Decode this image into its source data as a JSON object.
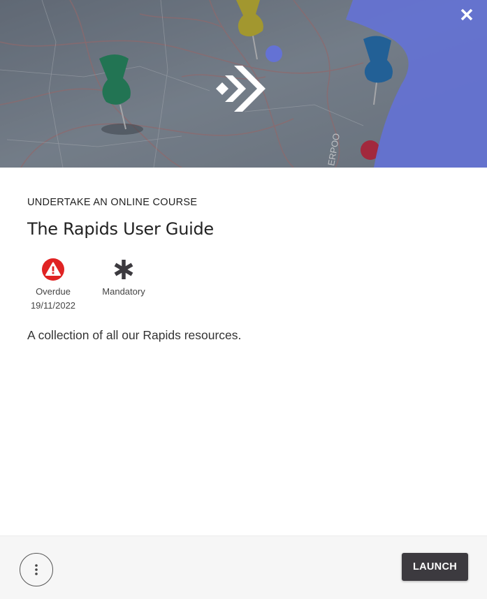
{
  "course": {
    "category": "UNDERTAKE AN ONLINE COURSE",
    "title": "The Rapids User Guide",
    "description": "A collection of all our Rapids resources."
  },
  "status": {
    "overdue_label": "Overdue",
    "due_date": "19/11/2022",
    "mandatory_label": "Mandatory"
  },
  "icons": {
    "close": "close-icon",
    "overdue": "warning-icon",
    "mandatory": "asterisk-icon",
    "more": "more-vertical-icon",
    "logo": "chevron-arrows-logo"
  },
  "colors": {
    "overdue": "#e02323",
    "accent_shape": "#6472d4",
    "launch_bg": "#3c3a3f"
  },
  "footer": {
    "launch_label": "LAUNCH"
  }
}
